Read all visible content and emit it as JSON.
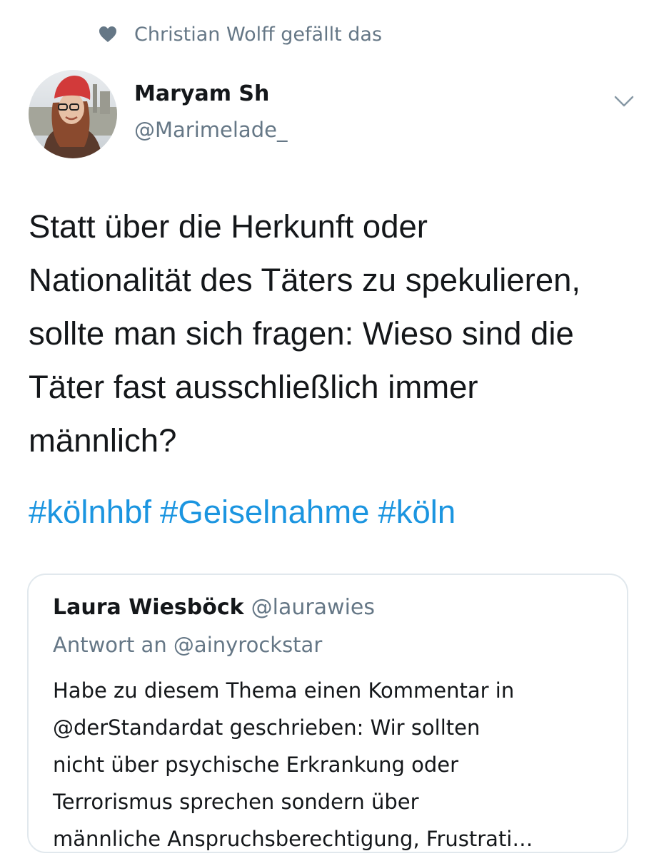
{
  "social_context": {
    "icon": "heart-icon",
    "text": "Christian Wolff gefällt das"
  },
  "tweet": {
    "author_name": "Maryam Sh",
    "author_handle": "@Marimelade_",
    "text_lines": [
      "Statt über die Herkunft oder",
      "Nationalität des Täters zu spekulieren,",
      "sollte man sich fragen: Wieso sind die",
      "Täter fast ausschließlich immer",
      "männlich?"
    ],
    "hashtags": [
      "#kölnhbf",
      "#Geiselnahme",
      "#köln"
    ]
  },
  "quoted_tweet": {
    "author_name": "Laura Wiesböck",
    "author_handle": "@laurawies",
    "reply_to": "Antwort an @ainyrockstar",
    "text_lines": [
      "Habe zu diesem Thema einen Kommentar in",
      "@derStandardat geschrieben: Wir sollten",
      "nicht über psychische Erkrankung oder",
      "Terrorismus sprechen sondern über",
      "männliche Anspruchsberechtigung, Frustrati…"
    ]
  },
  "colors": {
    "text": "#14171a",
    "secondary": "#657786",
    "link": "#1b95e0",
    "border": "#e1e8ed"
  }
}
